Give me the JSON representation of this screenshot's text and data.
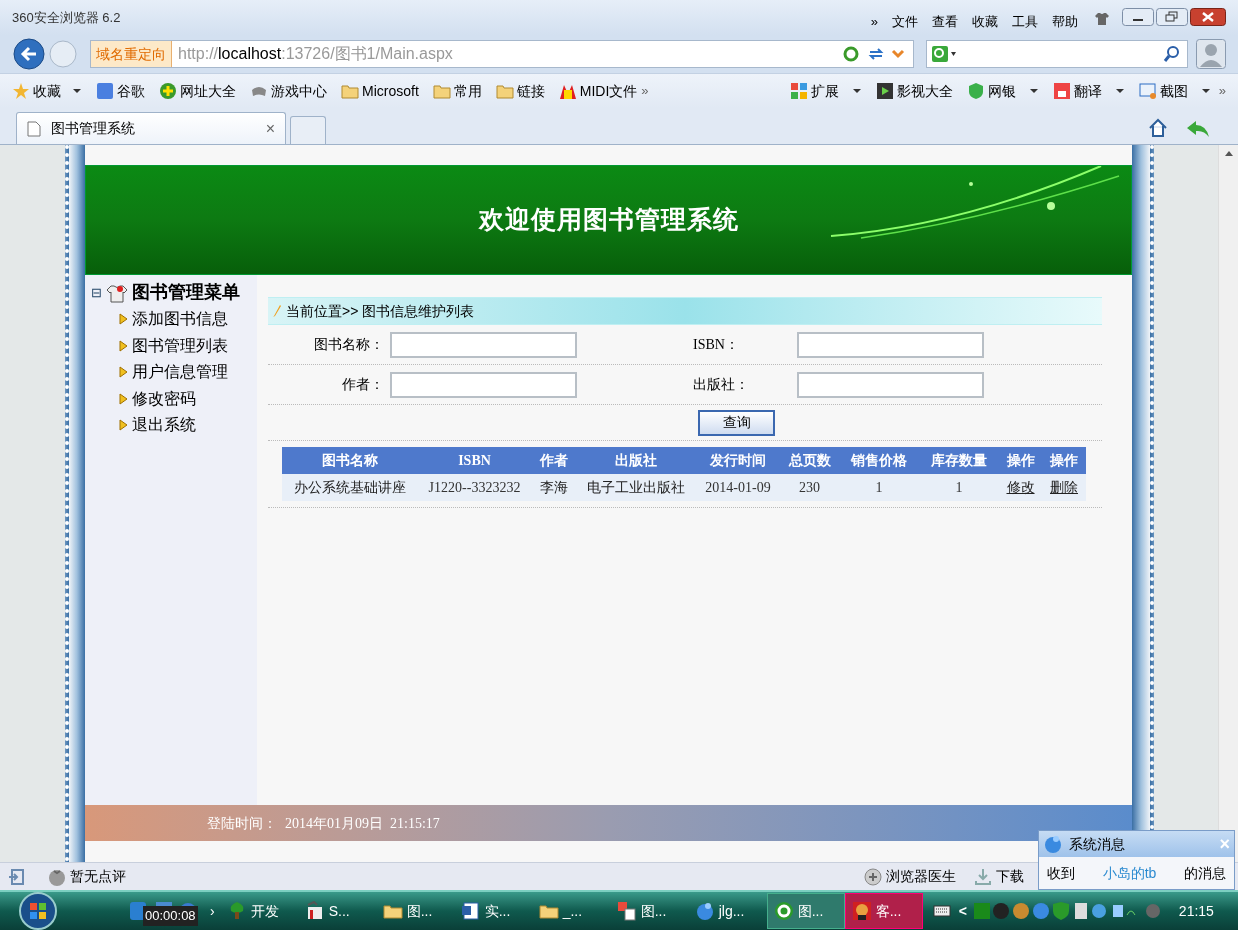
{
  "window": {
    "title": "360安全浏览器 6.2",
    "menu": [
      "»",
      "文件",
      "查看",
      "收藏",
      "工具",
      "帮助"
    ]
  },
  "address_bar": {
    "redirect_label": "域名重定向",
    "url_prefix": "http://",
    "url_host": "localhost",
    "url_rest": ":13726/图书1/Main.aspx"
  },
  "bookmarks": [
    {
      "label": "收藏",
      "dropdown": true
    },
    {
      "label": "谷歌",
      "dropdown": false
    },
    {
      "label": "网址大全",
      "dropdown": false
    },
    {
      "label": "游戏中心",
      "dropdown": false
    },
    {
      "label": "Microsoft",
      "dropdown": false
    },
    {
      "label": "常用",
      "dropdown": false
    },
    {
      "label": "链接",
      "dropdown": false
    },
    {
      "label": "MIDI文件",
      "dropdown": false
    }
  ],
  "bookmarks_more": "»",
  "toolbar_right": [
    {
      "label": "扩展",
      "dropdown": true
    },
    {
      "label": "影视大全",
      "dropdown": false
    },
    {
      "label": "网银",
      "dropdown": true
    },
    {
      "label": "翻译",
      "dropdown": true
    },
    {
      "label": "截图",
      "dropdown": true
    }
  ],
  "toolbar_right_more": "»",
  "tabs": [
    {
      "label": "图书管理系统",
      "selected": true,
      "close": "×"
    }
  ],
  "page": {
    "banner_title": "欢迎使用图书管理系统",
    "sidebar": {
      "title": "图书管理菜单",
      "expand_toggle": "⊟",
      "items": [
        {
          "label": "添加图书信息"
        },
        {
          "label": "图书管理列表"
        },
        {
          "label": "用户信息管理"
        },
        {
          "label": "修改密码"
        },
        {
          "label": "退出系统"
        }
      ]
    },
    "breadcrumb": "当前位置>> 图书信息维护列表",
    "search_form": {
      "fields": [
        {
          "label": "图书名称："
        },
        {
          "label": "ISBN："
        },
        {
          "label": "作者："
        },
        {
          "label": "出版社："
        }
      ],
      "button": "查询"
    },
    "table": {
      "columns": [
        "图书名称",
        "ISBN",
        "作者",
        "出版社",
        "发行时间",
        "总页数",
        "销售价格",
        "库存数量",
        "操作",
        "操作"
      ],
      "rows": [
        {
          "cells": [
            {
              "kind": "text",
              "text": "办公系统基础讲座"
            },
            {
              "kind": "serif",
              "text": "J1220--3323232"
            },
            {
              "kind": "text",
              "text": "李海"
            },
            {
              "kind": "text",
              "text": "电子工业出版社"
            },
            {
              "kind": "serif",
              "text": "2014-01-09"
            },
            {
              "kind": "serif",
              "text": "230"
            },
            {
              "kind": "serif",
              "text": "1"
            },
            {
              "kind": "serif",
              "text": "1"
            },
            {
              "kind": "link",
              "text": "修改"
            },
            {
              "kind": "link",
              "text": "删除"
            }
          ]
        }
      ]
    },
    "footer": {
      "label": "登陆时间：",
      "value": "2014年01月09日  21:15:17"
    }
  },
  "status_bar": {
    "rating": "暂无点评",
    "items": [
      "浏览器医生",
      "下载"
    ]
  },
  "notification": {
    "title": "系统消息",
    "close": "×",
    "prefix": "收到",
    "sender": "小岛的tb",
    "suffix": "的消息"
  },
  "taskbar": {
    "timer": "00:00:08",
    "chevron": "›",
    "items": [
      {
        "label": "开发",
        "active": false,
        "alert": false
      },
      {
        "label": "S...",
        "active": false,
        "alert": false
      },
      {
        "label": "图...",
        "active": false,
        "alert": false
      },
      {
        "label": "实...",
        "active": false,
        "alert": false
      },
      {
        "label": "_...",
        "active": false,
        "alert": false
      },
      {
        "label": "图...",
        "active": false,
        "alert": false
      },
      {
        "label": "jlg...",
        "active": false,
        "alert": false
      },
      {
        "label": "图...",
        "active": true,
        "alert": false
      },
      {
        "label": "客...",
        "active": false,
        "alert": true
      }
    ],
    "tray_arrow": "<",
    "clock": "21:15"
  }
}
